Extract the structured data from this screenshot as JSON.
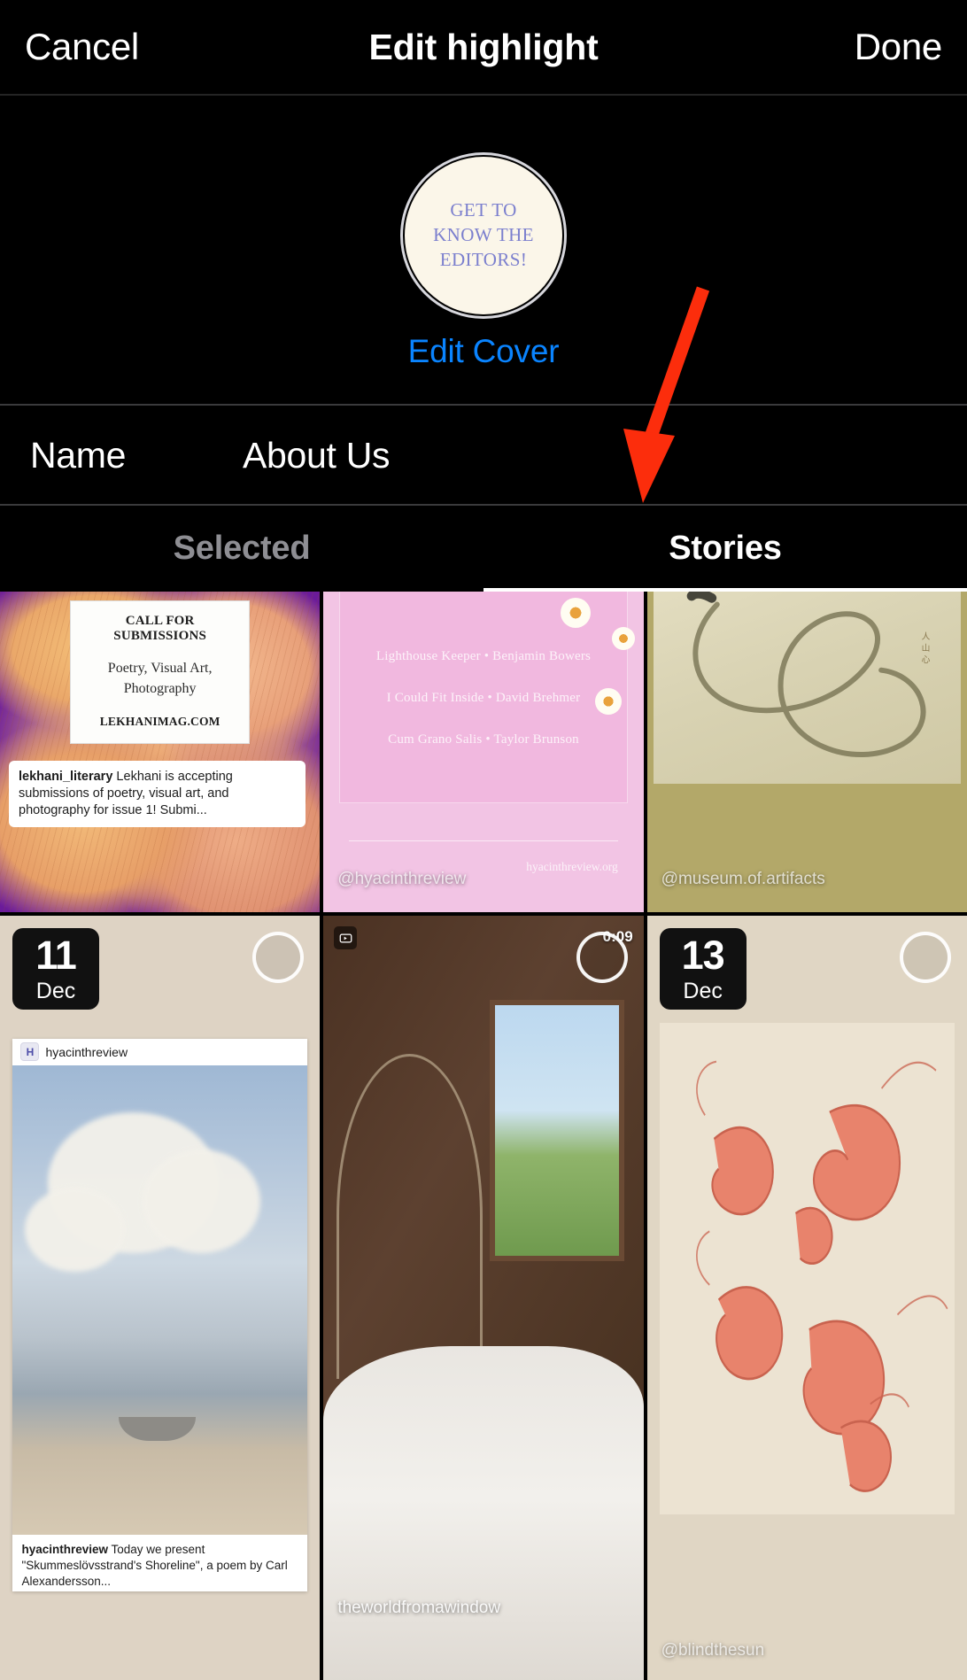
{
  "header": {
    "cancel_label": "Cancel",
    "title": "Edit highlight",
    "done_label": "Done"
  },
  "cover": {
    "text_line1": "GET TO",
    "text_line2": "KNOW THE",
    "text_line3": "EDITORS!",
    "edit_cover_label": "Edit Cover",
    "bg_color": "#fbf6e9",
    "text_color": "#7b7fce",
    "link_color": "#0a84ff"
  },
  "name_row": {
    "label": "Name",
    "value": "About Us"
  },
  "tabs": [
    {
      "label": "Selected",
      "active": false
    },
    {
      "label": "Stories",
      "active": true
    }
  ],
  "annotation": {
    "arrow_color": "#fc2d0c",
    "points_to": "Stories"
  },
  "stories": [
    {
      "id": "tile-1",
      "bg_color": "#6b1b9a",
      "card_title": "CALL FOR SUBMISSIONS",
      "card_body": "Poetry, Visual Art, Photography",
      "card_body_line1": "Poetry, Visual Art,",
      "card_body_line2": "Photography",
      "card_url": "LEKHANIMAG.COM",
      "caption_user": "lekhani_literary",
      "caption_text": " Lekhani is accepting submissions of poetry, visual art, and photography for issue 1! Submi...",
      "date_day": "",
      "date_month": "",
      "selected": false,
      "has_checkbox": false
    },
    {
      "id": "tile-2",
      "bg_color": "#f2c4e4",
      "poem_1": "Lighthouse Keeper • Benjamin Bowers",
      "poem_2": "I Could Fit Inside • David Brehmer",
      "poem_3": "Cum Grano Salis • Taylor Brunson",
      "site_url": "hyacinthreview.org",
      "handle": "@hyacinthreview",
      "date_day": "",
      "date_month": "",
      "selected": false,
      "has_checkbox": false
    },
    {
      "id": "tile-3",
      "bg_color": "#b3a869",
      "handle": "@museum.of.artifacts",
      "date_day": "",
      "date_month": "",
      "selected": false,
      "has_checkbox": false
    },
    {
      "id": "tile-4",
      "bg_color": "#ded3c4",
      "date_day": "11",
      "date_month": "Dec",
      "post_user": "hyacinthreview",
      "post_avatar_letter": "H",
      "caption_user": "hyacinthreview",
      "caption_text": " Today we present \"Skummeslövsstrand's Shoreline\", a poem by Carl Alexandersson...",
      "selected": false,
      "has_checkbox": true
    },
    {
      "id": "tile-5",
      "bg_color": "#4d362a",
      "video_duration": "0:09",
      "handle": "theworldfromawindow",
      "date_day": "",
      "date_month": "",
      "selected": false,
      "has_checkbox": true
    },
    {
      "id": "tile-6",
      "bg_color": "#e0d6c4",
      "date_day": "13",
      "date_month": "Dec",
      "handle": "@blindthesun",
      "selected": false,
      "has_checkbox": true
    }
  ]
}
